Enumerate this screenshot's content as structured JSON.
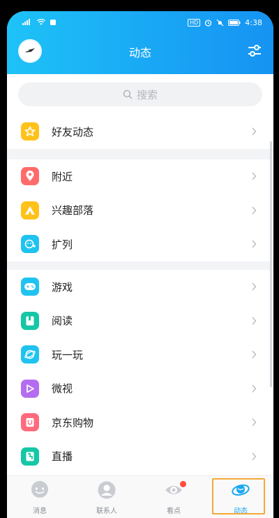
{
  "status_bar": {
    "time": "4:38",
    "right_badge": "HD"
  },
  "header": {
    "title": "动态"
  },
  "search": {
    "placeholder": "搜索"
  },
  "groups": [
    {
      "items": [
        {
          "label": "好友动态",
          "icon": "star-icon",
          "color": "#ffc21a"
        }
      ]
    },
    {
      "items": [
        {
          "label": "附近",
          "icon": "location-pin-icon",
          "color": "#ff6b6b"
        },
        {
          "label": "兴趣部落",
          "icon": "tent-icon",
          "color": "#ffc21a"
        },
        {
          "label": "扩列",
          "icon": "add-friend-icon",
          "color": "#20c3f0"
        }
      ]
    },
    {
      "items": [
        {
          "label": "游戏",
          "icon": "gamepad-icon",
          "color": "#20c3f0"
        },
        {
          "label": "阅读",
          "icon": "book-icon",
          "color": "#15c7a7"
        },
        {
          "label": "玩一玩",
          "icon": "planet-icon",
          "color": "#20c3f0"
        },
        {
          "label": "微视",
          "icon": "play-icon",
          "color": "#b46cf1"
        },
        {
          "label": "京东购物",
          "icon": "shopping-bag-icon",
          "color": "#ff6b7c"
        },
        {
          "label": "直播",
          "icon": "live-icon",
          "color": "#15c7a7"
        }
      ]
    }
  ],
  "tabs": [
    {
      "label": "消息",
      "icon": "message-icon"
    },
    {
      "label": "联系人",
      "icon": "contacts-icon"
    },
    {
      "label": "看点",
      "icon": "eye-icon"
    },
    {
      "label": "动态",
      "icon": "star-planet-icon"
    }
  ]
}
